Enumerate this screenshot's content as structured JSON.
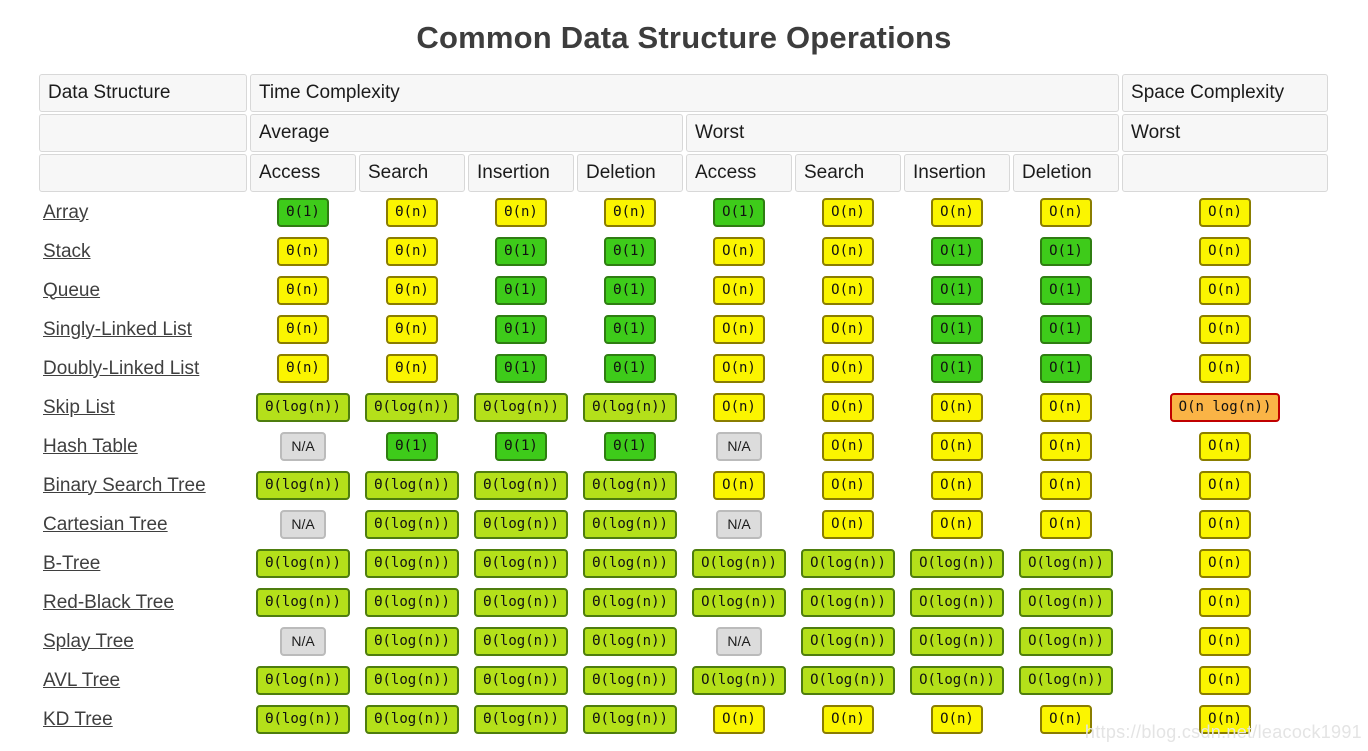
{
  "title": "Common Data Structure Operations",
  "watermark": "https://blog.csdn.net/leacock1991",
  "header": {
    "data_structure": "Data Structure",
    "time_complexity": "Time Complexity",
    "space_complexity": "Space Complexity",
    "average": "Average",
    "worst": "Worst",
    "worst_space": "Worst",
    "blank": "",
    "ops": [
      "Access",
      "Search",
      "Insertion",
      "Deletion"
    ]
  },
  "legend": {
    "constant": "#3ecb1a",
    "logarithmic": "#b4e01a",
    "linear": "#fbf500",
    "nlogn": "#fab446",
    "na": "#dcdcdc"
  },
  "chart_data": {
    "type": "table",
    "title": "Common Data Structure Operations",
    "column_groups": [
      {
        "label": "Data Structure",
        "columns": [
          ""
        ]
      },
      {
        "label": "Time Complexity",
        "subgroups": [
          {
            "label": "Average",
            "columns": [
              "Access",
              "Search",
              "Insertion",
              "Deletion"
            ]
          },
          {
            "label": "Worst",
            "columns": [
              "Access",
              "Search",
              "Insertion",
              "Deletion"
            ]
          }
        ]
      },
      {
        "label": "Space Complexity",
        "subgroups": [
          {
            "label": "Worst",
            "columns": [
              ""
            ]
          }
        ]
      }
    ],
    "rows": [
      {
        "name": "Array",
        "cells": [
          {
            "text": "Θ(1)",
            "kind": "const"
          },
          {
            "text": "Θ(n)",
            "kind": "linear"
          },
          {
            "text": "Θ(n)",
            "kind": "linear"
          },
          {
            "text": "Θ(n)",
            "kind": "linear"
          },
          {
            "text": "O(1)",
            "kind": "const"
          },
          {
            "text": "O(n)",
            "kind": "linear"
          },
          {
            "text": "O(n)",
            "kind": "linear"
          },
          {
            "text": "O(n)",
            "kind": "linear"
          },
          {
            "text": "O(n)",
            "kind": "linear"
          }
        ]
      },
      {
        "name": "Stack",
        "cells": [
          {
            "text": "Θ(n)",
            "kind": "linear"
          },
          {
            "text": "Θ(n)",
            "kind": "linear"
          },
          {
            "text": "Θ(1)",
            "kind": "const"
          },
          {
            "text": "Θ(1)",
            "kind": "const"
          },
          {
            "text": "O(n)",
            "kind": "linear"
          },
          {
            "text": "O(n)",
            "kind": "linear"
          },
          {
            "text": "O(1)",
            "kind": "const"
          },
          {
            "text": "O(1)",
            "kind": "const"
          },
          {
            "text": "O(n)",
            "kind": "linear"
          }
        ]
      },
      {
        "name": "Queue",
        "cells": [
          {
            "text": "Θ(n)",
            "kind": "linear"
          },
          {
            "text": "Θ(n)",
            "kind": "linear"
          },
          {
            "text": "Θ(1)",
            "kind": "const"
          },
          {
            "text": "Θ(1)",
            "kind": "const"
          },
          {
            "text": "O(n)",
            "kind": "linear"
          },
          {
            "text": "O(n)",
            "kind": "linear"
          },
          {
            "text": "O(1)",
            "kind": "const"
          },
          {
            "text": "O(1)",
            "kind": "const"
          },
          {
            "text": "O(n)",
            "kind": "linear"
          }
        ]
      },
      {
        "name": "Singly-Linked List",
        "cells": [
          {
            "text": "Θ(n)",
            "kind": "linear"
          },
          {
            "text": "Θ(n)",
            "kind": "linear"
          },
          {
            "text": "Θ(1)",
            "kind": "const"
          },
          {
            "text": "Θ(1)",
            "kind": "const"
          },
          {
            "text": "O(n)",
            "kind": "linear"
          },
          {
            "text": "O(n)",
            "kind": "linear"
          },
          {
            "text": "O(1)",
            "kind": "const"
          },
          {
            "text": "O(1)",
            "kind": "const"
          },
          {
            "text": "O(n)",
            "kind": "linear"
          }
        ]
      },
      {
        "name": "Doubly-Linked List",
        "cells": [
          {
            "text": "Θ(n)",
            "kind": "linear"
          },
          {
            "text": "Θ(n)",
            "kind": "linear"
          },
          {
            "text": "Θ(1)",
            "kind": "const"
          },
          {
            "text": "Θ(1)",
            "kind": "const"
          },
          {
            "text": "O(n)",
            "kind": "linear"
          },
          {
            "text": "O(n)",
            "kind": "linear"
          },
          {
            "text": "O(1)",
            "kind": "const"
          },
          {
            "text": "O(1)",
            "kind": "const"
          },
          {
            "text": "O(n)",
            "kind": "linear"
          }
        ]
      },
      {
        "name": "Skip List",
        "cells": [
          {
            "text": "Θ(log(n))",
            "kind": "log"
          },
          {
            "text": "Θ(log(n))",
            "kind": "log"
          },
          {
            "text": "Θ(log(n))",
            "kind": "log"
          },
          {
            "text": "Θ(log(n))",
            "kind": "log"
          },
          {
            "text": "O(n)",
            "kind": "linear"
          },
          {
            "text": "O(n)",
            "kind": "linear"
          },
          {
            "text": "O(n)",
            "kind": "linear"
          },
          {
            "text": "O(n)",
            "kind": "linear"
          },
          {
            "text": "O(n log(n))",
            "kind": "nlogn"
          }
        ]
      },
      {
        "name": "Hash Table",
        "cells": [
          {
            "text": "N/A",
            "kind": "na"
          },
          {
            "text": "Θ(1)",
            "kind": "const"
          },
          {
            "text": "Θ(1)",
            "kind": "const"
          },
          {
            "text": "Θ(1)",
            "kind": "const"
          },
          {
            "text": "N/A",
            "kind": "na"
          },
          {
            "text": "O(n)",
            "kind": "linear"
          },
          {
            "text": "O(n)",
            "kind": "linear"
          },
          {
            "text": "O(n)",
            "kind": "linear"
          },
          {
            "text": "O(n)",
            "kind": "linear"
          }
        ]
      },
      {
        "name": "Binary Search Tree",
        "cells": [
          {
            "text": "Θ(log(n))",
            "kind": "log"
          },
          {
            "text": "Θ(log(n))",
            "kind": "log"
          },
          {
            "text": "Θ(log(n))",
            "kind": "log"
          },
          {
            "text": "Θ(log(n))",
            "kind": "log"
          },
          {
            "text": "O(n)",
            "kind": "linear"
          },
          {
            "text": "O(n)",
            "kind": "linear"
          },
          {
            "text": "O(n)",
            "kind": "linear"
          },
          {
            "text": "O(n)",
            "kind": "linear"
          },
          {
            "text": "O(n)",
            "kind": "linear"
          }
        ]
      },
      {
        "name": "Cartesian Tree",
        "cells": [
          {
            "text": "N/A",
            "kind": "na"
          },
          {
            "text": "Θ(log(n))",
            "kind": "log"
          },
          {
            "text": "Θ(log(n))",
            "kind": "log"
          },
          {
            "text": "Θ(log(n))",
            "kind": "log"
          },
          {
            "text": "N/A",
            "kind": "na"
          },
          {
            "text": "O(n)",
            "kind": "linear"
          },
          {
            "text": "O(n)",
            "kind": "linear"
          },
          {
            "text": "O(n)",
            "kind": "linear"
          },
          {
            "text": "O(n)",
            "kind": "linear"
          }
        ]
      },
      {
        "name": "B-Tree",
        "cells": [
          {
            "text": "Θ(log(n))",
            "kind": "log"
          },
          {
            "text": "Θ(log(n))",
            "kind": "log"
          },
          {
            "text": "Θ(log(n))",
            "kind": "log"
          },
          {
            "text": "Θ(log(n))",
            "kind": "log"
          },
          {
            "text": "O(log(n))",
            "kind": "log"
          },
          {
            "text": "O(log(n))",
            "kind": "log"
          },
          {
            "text": "O(log(n))",
            "kind": "log"
          },
          {
            "text": "O(log(n))",
            "kind": "log"
          },
          {
            "text": "O(n)",
            "kind": "linear"
          }
        ]
      },
      {
        "name": "Red-Black Tree",
        "cells": [
          {
            "text": "Θ(log(n))",
            "kind": "log"
          },
          {
            "text": "Θ(log(n))",
            "kind": "log"
          },
          {
            "text": "Θ(log(n))",
            "kind": "log"
          },
          {
            "text": "Θ(log(n))",
            "kind": "log"
          },
          {
            "text": "O(log(n))",
            "kind": "log"
          },
          {
            "text": "O(log(n))",
            "kind": "log"
          },
          {
            "text": "O(log(n))",
            "kind": "log"
          },
          {
            "text": "O(log(n))",
            "kind": "log"
          },
          {
            "text": "O(n)",
            "kind": "linear"
          }
        ]
      },
      {
        "name": "Splay Tree",
        "cells": [
          {
            "text": "N/A",
            "kind": "na"
          },
          {
            "text": "Θ(log(n))",
            "kind": "log"
          },
          {
            "text": "Θ(log(n))",
            "kind": "log"
          },
          {
            "text": "Θ(log(n))",
            "kind": "log"
          },
          {
            "text": "N/A",
            "kind": "na"
          },
          {
            "text": "O(log(n))",
            "kind": "log"
          },
          {
            "text": "O(log(n))",
            "kind": "log"
          },
          {
            "text": "O(log(n))",
            "kind": "log"
          },
          {
            "text": "O(n)",
            "kind": "linear"
          }
        ]
      },
      {
        "name": "AVL Tree",
        "cells": [
          {
            "text": "Θ(log(n))",
            "kind": "log"
          },
          {
            "text": "Θ(log(n))",
            "kind": "log"
          },
          {
            "text": "Θ(log(n))",
            "kind": "log"
          },
          {
            "text": "Θ(log(n))",
            "kind": "log"
          },
          {
            "text": "O(log(n))",
            "kind": "log"
          },
          {
            "text": "O(log(n))",
            "kind": "log"
          },
          {
            "text": "O(log(n))",
            "kind": "log"
          },
          {
            "text": "O(log(n))",
            "kind": "log"
          },
          {
            "text": "O(n)",
            "kind": "linear"
          }
        ]
      },
      {
        "name": "KD Tree",
        "cells": [
          {
            "text": "Θ(log(n))",
            "kind": "log"
          },
          {
            "text": "Θ(log(n))",
            "kind": "log"
          },
          {
            "text": "Θ(log(n))",
            "kind": "log"
          },
          {
            "text": "Θ(log(n))",
            "kind": "log"
          },
          {
            "text": "O(n)",
            "kind": "linear"
          },
          {
            "text": "O(n)",
            "kind": "linear"
          },
          {
            "text": "O(n)",
            "kind": "linear"
          },
          {
            "text": "O(n)",
            "kind": "linear"
          },
          {
            "text": "O(n)",
            "kind": "linear"
          }
        ]
      }
    ]
  }
}
